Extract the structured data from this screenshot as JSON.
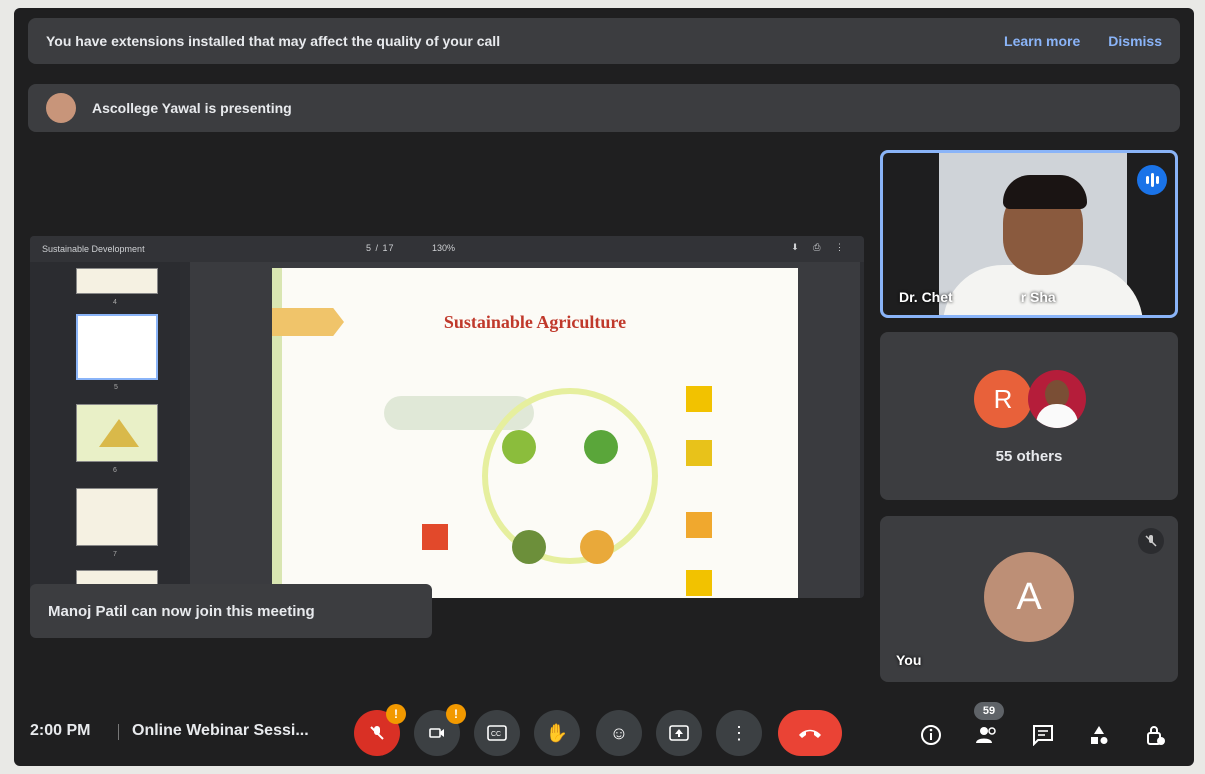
{
  "banners": {
    "extension": {
      "message": "You have extensions installed that may affect the quality of your call",
      "learn_more": "Learn more",
      "dismiss": "Dismiss"
    },
    "presenting": {
      "message": "Ascollege Yawal is presenting"
    }
  },
  "shared_doc": {
    "title": "Sustainable Development",
    "pager": "5 / 17",
    "zoom": "130%",
    "thumb_numbers": [
      "4",
      "5",
      "6",
      "7"
    ],
    "slide_title": "Sustainable Agriculture"
  },
  "toast": {
    "message": "Manoj Patil can now join this meeting"
  },
  "tiles": {
    "speaker_name": "Dr. Chet",
    "speaker_name_tail": "r Sha",
    "others_avatar_letter": "R",
    "others_label": "55 others",
    "you_avatar_letter": "A",
    "you_label": "You"
  },
  "bottom_bar": {
    "time": "2:00 PM",
    "meeting_name": "Online Webinar Sessi...",
    "people_count": "59",
    "warning_glyph": "!"
  },
  "colors": {
    "accent": "#8ab4f8",
    "end_call": "#ea4335",
    "warning": "#f29900",
    "background": "#1f1f20"
  }
}
